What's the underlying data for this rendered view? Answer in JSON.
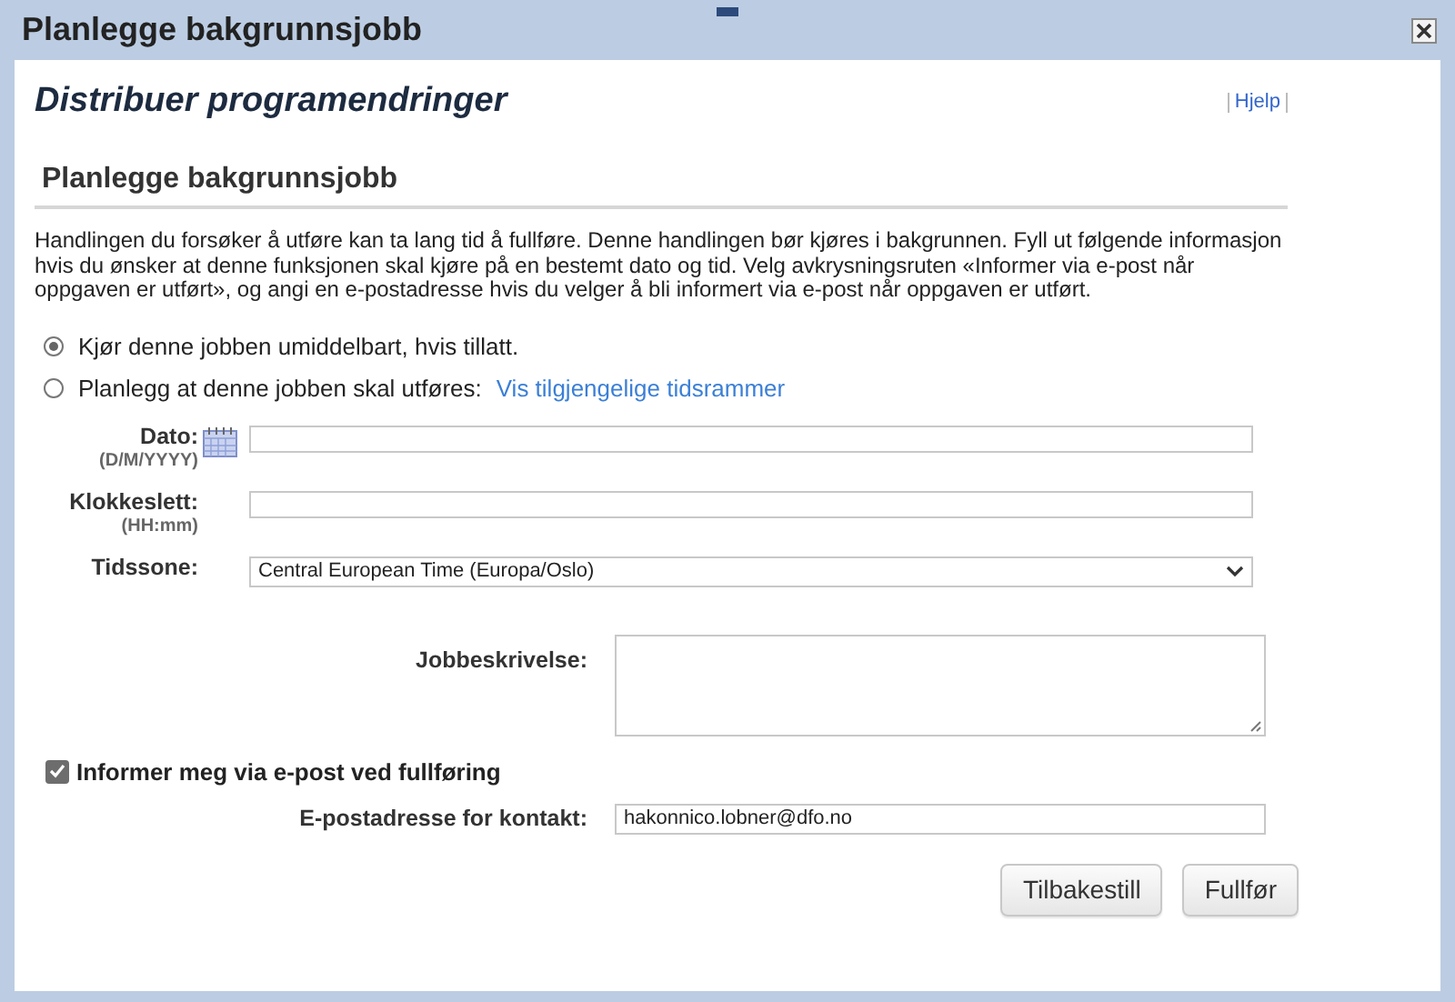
{
  "window": {
    "title": "Planlegge bakgrunnsjobb"
  },
  "page_title": "Distribuer programendringer",
  "help_link": "Hjelp",
  "section_title": "Planlegge bakgrunnsjobb",
  "intro": "Handlingen du forsøker å utføre kan ta lang tid å fullføre. Denne handlingen bør kjøres i bakgrunnen. Fyll ut følgende informasjon hvis du ønsker at denne funksjonen skal kjøre på en bestemt dato og tid. Velg avkrysningsruten «Informer via e-post når oppgaven er utført», og angi en e-postadresse hvis du velger å bli informert via e-post når oppgaven er utført.",
  "run_options": [
    {
      "label": "Kjør denne jobben umiddelbart, hvis tillatt.",
      "selected": true
    },
    {
      "label": "Planlegg at denne jobben skal utføres:",
      "link": "Vis tilgjengelige tidsrammer",
      "selected": false
    }
  ],
  "date": {
    "label": "Dato:",
    "hint": "(D/M/YYYY)"
  },
  "time": {
    "label": "Klokkeslett:",
    "hint": "(HH:mm)"
  },
  "timezone": {
    "label": "Tidssone:",
    "value": "Central European Time (Europa/Oslo)"
  },
  "description": {
    "label": "Jobbeskrivelse:"
  },
  "notify": {
    "label": "Informer meg via e-post ved fullføring",
    "checked": true
  },
  "email": {
    "label": "E-postadresse for kontakt:",
    "value": "hakonnico.lobner@dfo.no"
  },
  "buttons": [
    "Tilbakestill",
    "Fullfør"
  ]
}
